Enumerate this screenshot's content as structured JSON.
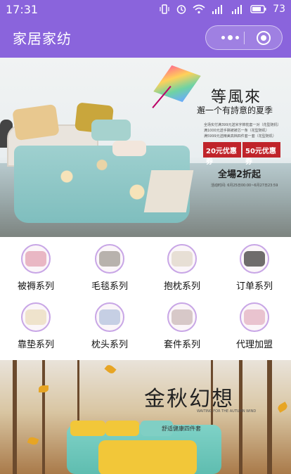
{
  "status_bar": {
    "time": "17:31",
    "battery": "73",
    "icons": [
      "vibrate-icon",
      "alarm-icon",
      "wifi-icon",
      "signal-4g-icon",
      "signal-icon",
      "battery-icon"
    ]
  },
  "navbar": {
    "title": "家居家纺",
    "menu_icon": "more-dots-icon",
    "close_icon": "target-icon"
  },
  "banner1": {
    "title": "等風來",
    "subtitle": "邂一个有詩意的夏季",
    "promo_lines": [
      "全场实付满399元送米字棉枕套一对（花型随机）",
      "满1000元送手撕被被芯一条（花型随机）",
      "满5999元送精美高档四件套一套（花型随机）"
    ],
    "coupon1": "20元优惠券",
    "coupon2": "50元优惠券",
    "sale": "全場2折起",
    "date": "活动时间: 6月25日00:00~6月27日23:59"
  },
  "categories": [
    {
      "label": "被褥系列",
      "icon": "quilt-icon",
      "color": "#e9b7c4"
    },
    {
      "label": "毛毯系列",
      "icon": "blanket-icon",
      "color": "#b8b2ad"
    },
    {
      "label": "抱枕系列",
      "icon": "cushion-icon",
      "color": "#e7dfd5"
    },
    {
      "label": "订单系列",
      "icon": "order-icon",
      "color": "#6f6c6c"
    },
    {
      "label": "靠垫系列",
      "icon": "back-cushion-icon",
      "color": "#efe3cc"
    },
    {
      "label": "枕头系列",
      "icon": "pillow-icon",
      "color": "#c6cfe4"
    },
    {
      "label": "套件系列",
      "icon": "bedding-set-icon",
      "color": "#d7c8c8"
    },
    {
      "label": "代理加盟",
      "icon": "franchise-icon",
      "color": "#e9c3cf"
    }
  ],
  "banner2": {
    "title": "金秋幻想",
    "english": "WAITING FOR THE AUTUMN WIND",
    "subtitle": "舒适健康四件套"
  },
  "colors": {
    "nav": "#8a64dc",
    "coupon": "#c0242a",
    "category_ring": "#c8a6e6"
  }
}
